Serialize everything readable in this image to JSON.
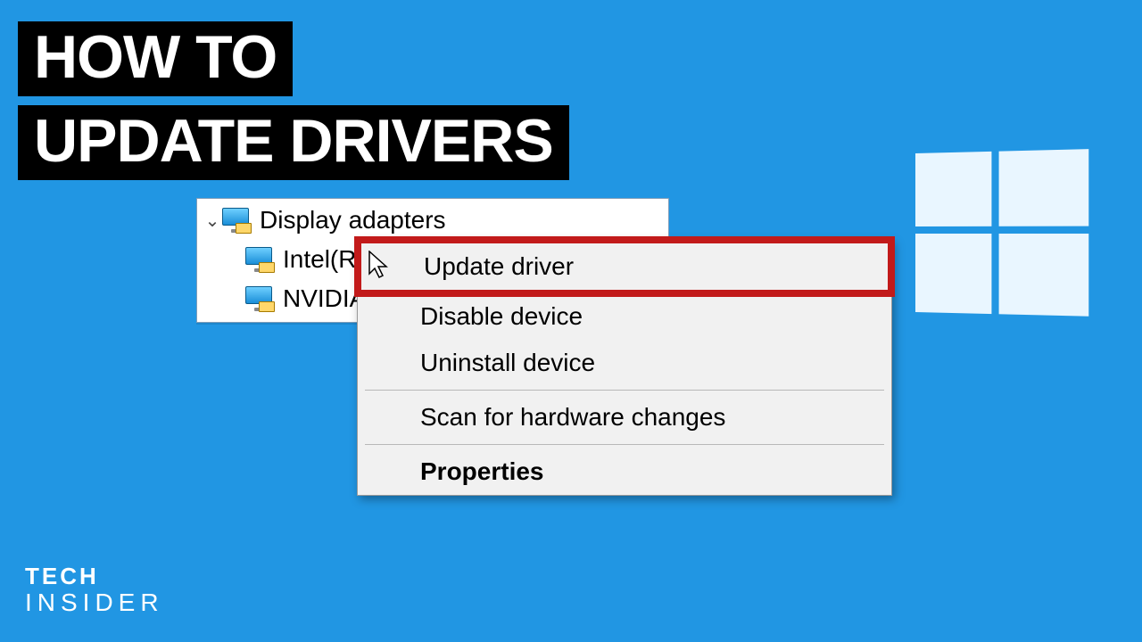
{
  "title": {
    "line1": "HOW TO",
    "line2": "UPDATE DRIVERS"
  },
  "tree": {
    "parent": "Display adapters",
    "children": [
      "Intel(R)",
      "NVIDIA"
    ]
  },
  "context_menu": {
    "items": [
      {
        "label": "Update driver",
        "highlight": true
      },
      {
        "label": "Disable device"
      },
      {
        "label": "Uninstall device"
      }
    ],
    "scan": "Scan for hardware changes",
    "properties": "Properties"
  },
  "brand": {
    "line1": "TECH",
    "line2": "INSIDER"
  }
}
